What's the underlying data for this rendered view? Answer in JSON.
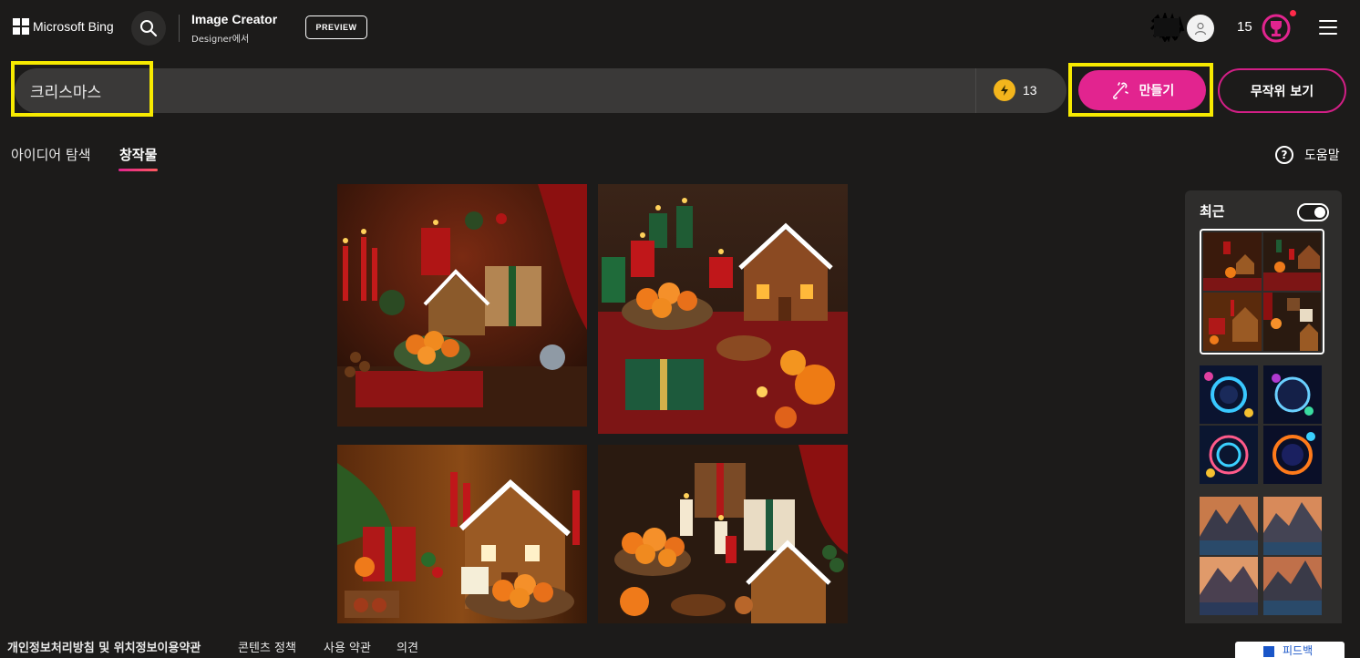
{
  "header": {
    "brand": "Microsoft Bing",
    "app_title": "Image Creator",
    "app_subtitle": "Designer에서",
    "preview_badge": "PREVIEW",
    "reward_points": "15",
    "icons": [
      "windows-logo-icon",
      "search-icon",
      "profile-icon",
      "rewards-icon",
      "hamburger-menu-icon"
    ]
  },
  "prompt": {
    "value": "크리스마스",
    "boost_count": "13",
    "create_label": "만들기",
    "surprise_label": "무작위 보기"
  },
  "tabs": [
    {
      "label": "아이디어 탐색",
      "active": false
    },
    {
      "label": "창작물",
      "active": true
    }
  ],
  "help_label": "도움말",
  "images": [
    {
      "name": "christmas-table-gingerbread-1"
    },
    {
      "name": "christmas-table-gingerbread-2"
    },
    {
      "name": "christmas-table-gingerbread-3"
    },
    {
      "name": "christmas-table-gingerbread-4"
    }
  ],
  "recent": {
    "title": "최근",
    "toggle_on": true,
    "groups": [
      {
        "name": "christmas-group",
        "selected": true
      },
      {
        "name": "neon-clock-group",
        "selected": false
      },
      {
        "name": "mountain-landscape-group",
        "selected": false
      }
    ]
  },
  "footer": {
    "links": [
      "개인정보처리방침 및 위치정보이용약관",
      "콘텐츠 정책",
      "사용 약관",
      "의견"
    ],
    "feedback_label": "피드백"
  },
  "colors": {
    "background": "#1c1b1a",
    "accent": "#e2248f",
    "highlight_box": "#f7ea00",
    "prompt_bar": "#3a3938"
  }
}
